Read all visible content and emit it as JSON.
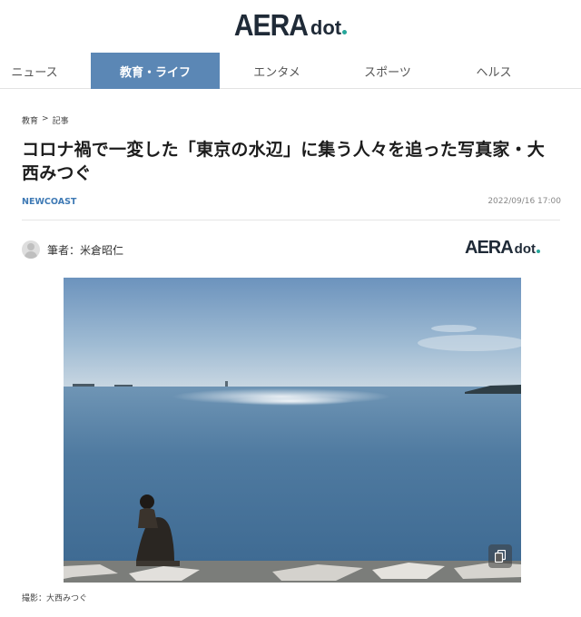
{
  "header": {
    "logo_main": "AERA",
    "logo_sub": "dot"
  },
  "nav": {
    "tabs": [
      {
        "label": "ニュース",
        "active": false
      },
      {
        "label": "教育・ライフ",
        "active": true
      },
      {
        "label": "エンタメ",
        "active": false
      },
      {
        "label": "スポーツ",
        "active": false
      },
      {
        "label": "ヘルス",
        "active": false
      }
    ]
  },
  "breadcrumb": {
    "items": [
      "教育",
      ">",
      "記事"
    ]
  },
  "article": {
    "title": "コロナ禍で一変した「東京の水辺」に集う人々を追った写真家・大西みつぐ",
    "category": "NEWCOAST",
    "date": "2022/09/16 17:00",
    "author": "筆者：米倉昭仁",
    "publisher_logo_main": "AERA",
    "publisher_logo_sub": "dot",
    "image_caption": "撮影：大西みつぐ"
  },
  "colors": {
    "accent": "#5b87b5",
    "category": "#3f7ab5",
    "logo_dot": "#26a69a"
  },
  "icons": {
    "author_avatar": "avatar-icon",
    "expand": "copy-expand-icon"
  }
}
